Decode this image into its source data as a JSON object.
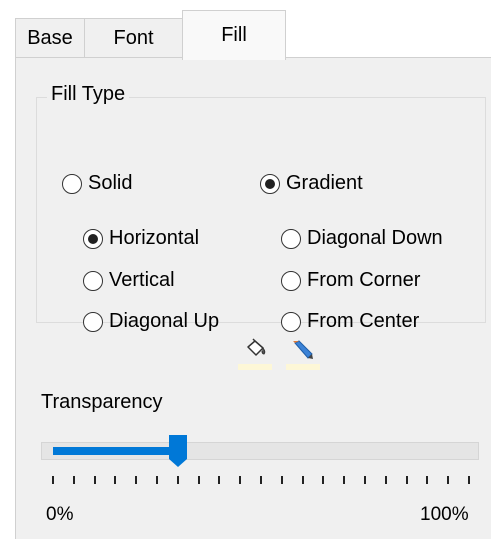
{
  "tabs": [
    {
      "label": "Base",
      "active": false
    },
    {
      "label": "Font",
      "active": false
    },
    {
      "label": "Fill",
      "active": true
    }
  ],
  "fill_type": {
    "legend": "Fill Type",
    "type_options": [
      {
        "label": "Solid",
        "checked": false
      },
      {
        "label": "Gradient",
        "checked": true
      }
    ],
    "gradient_options": [
      {
        "label": "Horizontal",
        "checked": true
      },
      {
        "label": "Vertical",
        "checked": false
      },
      {
        "label": "Diagonal Up",
        "checked": false
      },
      {
        "label": "Diagonal Down",
        "checked": false
      },
      {
        "label": "From Corner",
        "checked": false
      },
      {
        "label": "From Center",
        "checked": false
      }
    ]
  },
  "toolbar": {
    "icons": [
      "paint-bucket-icon",
      "pencil-icon"
    ],
    "accent": "#fdf7d7"
  },
  "transparency": {
    "label": "Transparency",
    "value_percent": 30,
    "min_label": "0%",
    "max_label": "100%",
    "accent_color": "#0078d7"
  }
}
